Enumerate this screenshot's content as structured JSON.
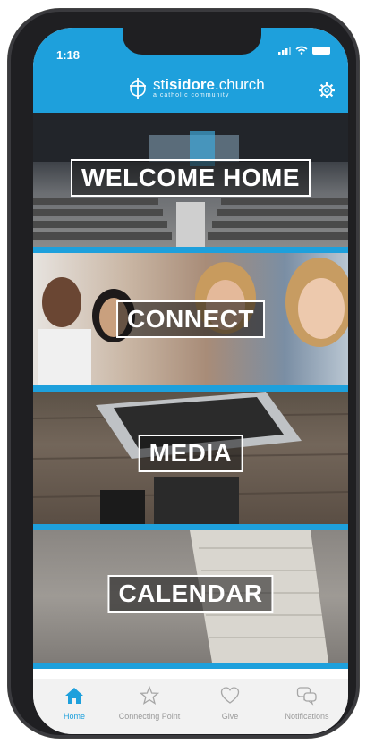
{
  "status": {
    "time": "1:18"
  },
  "header": {
    "logo_prefix": "st",
    "logo_bold": "isidore",
    "logo_suffix": ".church",
    "tagline": "a catholic community"
  },
  "tiles": [
    {
      "label": "WELCOME HOME"
    },
    {
      "label": "CONNECT"
    },
    {
      "label": "MEDIA"
    },
    {
      "label": "CALENDAR"
    }
  ],
  "tabs": [
    {
      "label": "Home",
      "icon": "home-icon"
    },
    {
      "label": "Connecting Point",
      "icon": "star-icon"
    },
    {
      "label": "Give",
      "icon": "heart-icon"
    },
    {
      "label": "Notifications",
      "icon": "chat-icon"
    }
  ],
  "colors": {
    "accent": "#1ea0dc",
    "tabbar": "#f2f2f2",
    "phone": "#1f1f22"
  }
}
